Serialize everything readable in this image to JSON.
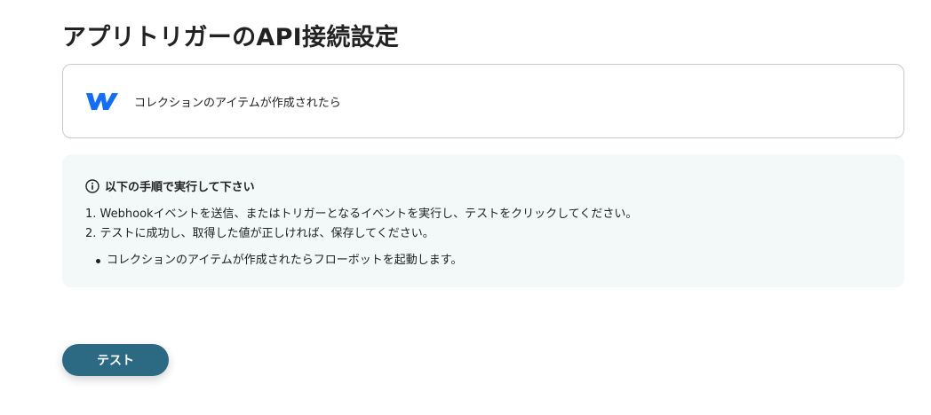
{
  "header": {
    "title": "アプリトリガーのAPI接続設定"
  },
  "trigger": {
    "app_icon": "webflow-logo",
    "label": "コレクションのアイテムが作成されたら",
    "brand_color": "#146ef5"
  },
  "instructions": {
    "icon": "info-icon",
    "heading": "以下の手順で実行して下さい",
    "steps": [
      "1. Webhookイベントを送信、またはトリガーとなるイベントを実行し、テストをクリックしてください。",
      "2. テストに成功し、取得した値が正しければ、保存してください。"
    ],
    "bullets": [
      "コレクションのアイテムが作成されたらフローボットを起動します。"
    ],
    "background_color": "#f3f8f8"
  },
  "actions": {
    "test_label": "テスト",
    "button_color": "#2c6a84"
  }
}
